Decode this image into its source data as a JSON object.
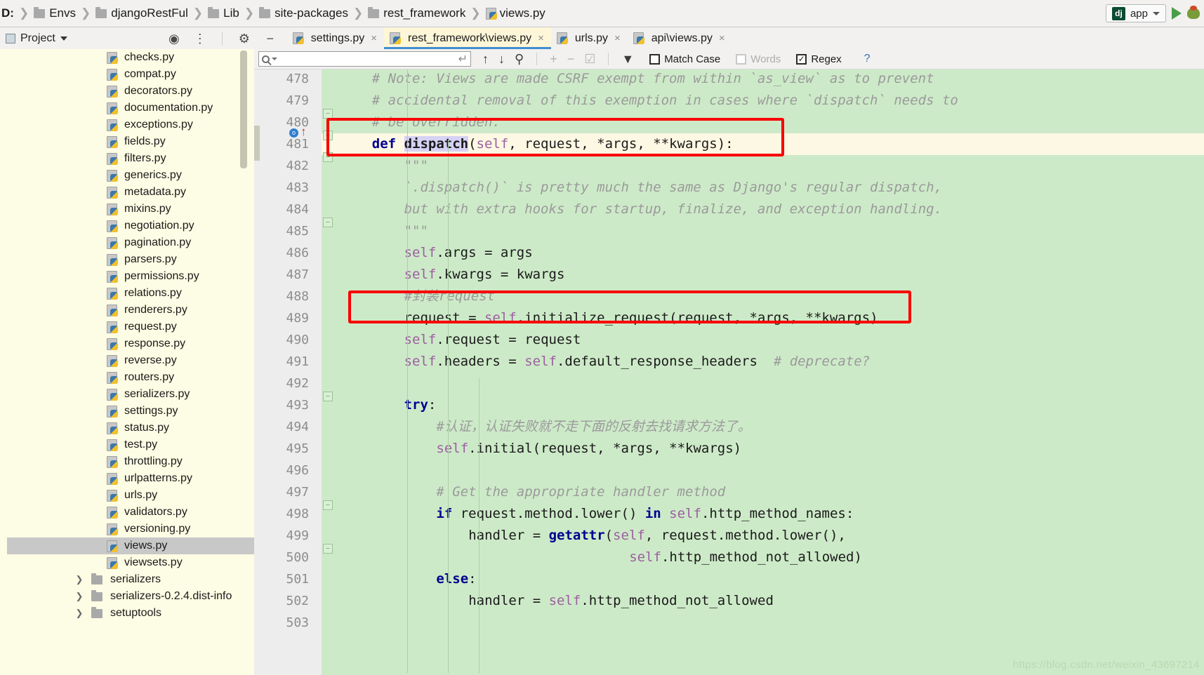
{
  "window": {
    "breadcrumb": [
      {
        "label": "D:",
        "icon": "drive-icon",
        "type": "drive"
      },
      {
        "label": "Envs",
        "icon": "folder-icon",
        "type": "folder"
      },
      {
        "label": "djangoRestFul",
        "icon": "folder-icon",
        "type": "folder"
      },
      {
        "label": "Lib",
        "icon": "folder-icon",
        "type": "folder"
      },
      {
        "label": "site-packages",
        "icon": "folder-icon",
        "type": "folder"
      },
      {
        "label": "rest_framework",
        "icon": "folder-icon",
        "type": "folder"
      },
      {
        "label": "views.py",
        "icon": "python-file-icon",
        "type": "file"
      }
    ],
    "run_config": {
      "badge": "dj",
      "label": "app",
      "icon": "chevron-down-icon"
    },
    "run_button_icon": "run-triangle-icon",
    "debug_button_icon": "debug-bug-icon"
  },
  "toolbar": {
    "project_label": "Project",
    "project_caret_icon": "triangle-down-icon",
    "icons": [
      "locate-target-icon",
      "collapse-all-icon",
      "settings-gear-icon",
      "hide-minus-icon"
    ]
  },
  "tabs": [
    {
      "label": "settings.py",
      "icon": "python-file-icon",
      "close": "×",
      "active": false
    },
    {
      "label": "rest_framework\\views.py",
      "icon": "python-file-icon",
      "close": "×",
      "active": true
    },
    {
      "label": "urls.py",
      "icon": "python-file-icon",
      "close": "×",
      "active": false
    },
    {
      "label": "api\\views.py",
      "icon": "python-file-icon",
      "close": "×",
      "active": false
    }
  ],
  "find": {
    "placeholder": "",
    "value": "",
    "search_icon": "magnifier-icon",
    "dropdown_icon": "caret-down-icon",
    "wrap_icon": "return-arrow-icon",
    "prev_icon": "arrow-up-icon",
    "next_icon": "arrow-down-icon",
    "select_all_icon": "select-all-occurrences-icon",
    "add_line_icon": "add-selection-icon",
    "remove_line_icon": "remove-selection-icon",
    "select_lines_icon": "select-lines-icon",
    "filter_icon": "filter-funnel-icon",
    "match_case": {
      "label": "Match Case",
      "checked": false,
      "enabled": true
    },
    "words": {
      "label": "Words",
      "checked": false,
      "enabled": false
    },
    "regex": {
      "label": "Regex",
      "checked": true,
      "enabled": true
    },
    "help": "?"
  },
  "sidebar": {
    "files": [
      {
        "label": "checks.py",
        "type": "file",
        "selected": false
      },
      {
        "label": "compat.py",
        "type": "file",
        "selected": false
      },
      {
        "label": "decorators.py",
        "type": "file",
        "selected": false
      },
      {
        "label": "documentation.py",
        "type": "file",
        "selected": false
      },
      {
        "label": "exceptions.py",
        "type": "file",
        "selected": false
      },
      {
        "label": "fields.py",
        "type": "file",
        "selected": false
      },
      {
        "label": "filters.py",
        "type": "file",
        "selected": false
      },
      {
        "label": "generics.py",
        "type": "file",
        "selected": false
      },
      {
        "label": "metadata.py",
        "type": "file",
        "selected": false
      },
      {
        "label": "mixins.py",
        "type": "file",
        "selected": false
      },
      {
        "label": "negotiation.py",
        "type": "file",
        "selected": false
      },
      {
        "label": "pagination.py",
        "type": "file",
        "selected": false
      },
      {
        "label": "parsers.py",
        "type": "file",
        "selected": false
      },
      {
        "label": "permissions.py",
        "type": "file",
        "selected": false
      },
      {
        "label": "relations.py",
        "type": "file",
        "selected": false
      },
      {
        "label": "renderers.py",
        "type": "file",
        "selected": false
      },
      {
        "label": "request.py",
        "type": "file",
        "selected": false
      },
      {
        "label": "response.py",
        "type": "file",
        "selected": false
      },
      {
        "label": "reverse.py",
        "type": "file",
        "selected": false
      },
      {
        "label": "routers.py",
        "type": "file",
        "selected": false
      },
      {
        "label": "serializers.py",
        "type": "file",
        "selected": false
      },
      {
        "label": "settings.py",
        "type": "file",
        "selected": false
      },
      {
        "label": "status.py",
        "type": "file",
        "selected": false
      },
      {
        "label": "test.py",
        "type": "file",
        "selected": false
      },
      {
        "label": "throttling.py",
        "type": "file",
        "selected": false
      },
      {
        "label": "urlpatterns.py",
        "type": "file",
        "selected": false
      },
      {
        "label": "urls.py",
        "type": "file",
        "selected": false
      },
      {
        "label": "validators.py",
        "type": "file",
        "selected": false
      },
      {
        "label": "versioning.py",
        "type": "file",
        "selected": false
      },
      {
        "label": "views.py",
        "type": "file",
        "selected": true
      },
      {
        "label": "viewsets.py",
        "type": "file",
        "selected": false
      },
      {
        "label": "serializers",
        "type": "folder",
        "selected": false
      },
      {
        "label": "serializers-0.2.4.dist-info",
        "type": "folder",
        "selected": false
      },
      {
        "label": "setuptools",
        "type": "folder",
        "selected": false
      }
    ]
  },
  "editor": {
    "language": "python",
    "first_line": 478,
    "lines": [
      {
        "num": "478",
        "indent": 4,
        "tokens": [
          {
            "t": "comment",
            "v": "# Note: Views are made CSRF exempt from within `as_view` as to prevent"
          }
        ]
      },
      {
        "num": "479",
        "indent": 4,
        "tokens": [
          {
            "t": "comment",
            "v": "# accidental removal of this exemption in cases where `dispatch` needs to"
          }
        ]
      },
      {
        "num": "480",
        "indent": 4,
        "tokens": [
          {
            "t": "comment",
            "v": "# be overridden."
          }
        ]
      },
      {
        "num": "481",
        "indent": 4,
        "tokens": [
          {
            "t": "kw",
            "v": "def "
          },
          {
            "t": "fn-sel",
            "v": "dispatch"
          },
          {
            "t": "plain",
            "v": "("
          },
          {
            "t": "self",
            "v": "self"
          },
          {
            "t": "plain",
            "v": ", request, *args, **kwargs):"
          }
        ]
      },
      {
        "num": "482",
        "indent": 8,
        "tokens": [
          {
            "t": "docstring",
            "v": "\"\"\""
          }
        ]
      },
      {
        "num": "483",
        "indent": 8,
        "tokens": [
          {
            "t": "docstring",
            "v": "`.dispatch()` is pretty much the same as Django's regular dispatch,"
          }
        ]
      },
      {
        "num": "484",
        "indent": 8,
        "tokens": [
          {
            "t": "docstring",
            "v": "but with extra hooks for startup, finalize, and exception handling."
          }
        ]
      },
      {
        "num": "485",
        "indent": 8,
        "tokens": [
          {
            "t": "docstring",
            "v": "\"\"\""
          }
        ]
      },
      {
        "num": "486",
        "indent": 8,
        "tokens": [
          {
            "t": "self",
            "v": "self"
          },
          {
            "t": "plain",
            "v": ".args = args"
          }
        ]
      },
      {
        "num": "487",
        "indent": 8,
        "tokens": [
          {
            "t": "self",
            "v": "self"
          },
          {
            "t": "plain",
            "v": ".kwargs = kwargs"
          }
        ]
      },
      {
        "num": "488",
        "indent": 8,
        "tokens": [
          {
            "t": "comment",
            "v": "#封装request"
          }
        ]
      },
      {
        "num": "489",
        "indent": 8,
        "tokens": [
          {
            "t": "plain",
            "v": "request = "
          },
          {
            "t": "self",
            "v": "self"
          },
          {
            "t": "plain",
            "v": ".initialize_request(request, *args, **kwargs)"
          }
        ]
      },
      {
        "num": "490",
        "indent": 8,
        "tokens": [
          {
            "t": "self",
            "v": "self"
          },
          {
            "t": "plain",
            "v": ".request = request"
          }
        ]
      },
      {
        "num": "491",
        "indent": 8,
        "tokens": [
          {
            "t": "self",
            "v": "self"
          },
          {
            "t": "plain",
            "v": ".headers = "
          },
          {
            "t": "self",
            "v": "self"
          },
          {
            "t": "plain",
            "v": ".default_response_headers  "
          },
          {
            "t": "comment",
            "v": "# deprecate?"
          }
        ]
      },
      {
        "num": "492",
        "indent": 0,
        "tokens": []
      },
      {
        "num": "493",
        "indent": 8,
        "tokens": [
          {
            "t": "kw",
            "v": "try"
          },
          {
            "t": "plain",
            "v": ":"
          }
        ]
      },
      {
        "num": "494",
        "indent": 12,
        "tokens": [
          {
            "t": "comment",
            "v": "#认证，认证失败就不走下面的反射去找请求方法了。"
          }
        ]
      },
      {
        "num": "495",
        "indent": 12,
        "tokens": [
          {
            "t": "self",
            "v": "self"
          },
          {
            "t": "plain",
            "v": ".initial(request, *args, **kwargs)"
          }
        ]
      },
      {
        "num": "496",
        "indent": 0,
        "tokens": []
      },
      {
        "num": "497",
        "indent": 12,
        "tokens": [
          {
            "t": "comment",
            "v": "# Get the appropriate handler method"
          }
        ]
      },
      {
        "num": "498",
        "indent": 12,
        "tokens": [
          {
            "t": "kw",
            "v": "if"
          },
          {
            "t": "plain",
            "v": " request.method.lower() "
          },
          {
            "t": "kw",
            "v": "in"
          },
          {
            "t": "plain",
            "v": " "
          },
          {
            "t": "self",
            "v": "self"
          },
          {
            "t": "plain",
            "v": ".http_method_names:"
          }
        ]
      },
      {
        "num": "499",
        "indent": 16,
        "tokens": [
          {
            "t": "plain",
            "v": "handler = "
          },
          {
            "t": "builtin",
            "v": "getattr"
          },
          {
            "t": "plain",
            "v": "("
          },
          {
            "t": "self",
            "v": "self"
          },
          {
            "t": "plain",
            "v": ", request.method.lower(),"
          }
        ]
      },
      {
        "num": "500",
        "indent": 36,
        "tokens": [
          {
            "t": "self",
            "v": "self"
          },
          {
            "t": "plain",
            "v": ".http_method_not_allowed)"
          }
        ]
      },
      {
        "num": "501",
        "indent": 12,
        "tokens": [
          {
            "t": "kw",
            "v": "else"
          },
          {
            "t": "plain",
            "v": ":"
          }
        ]
      },
      {
        "num": "502",
        "indent": 16,
        "tokens": [
          {
            "t": "plain",
            "v": "handler = "
          },
          {
            "t": "self",
            "v": "self"
          },
          {
            "t": "plain",
            "v": ".http_method_not_allowed"
          }
        ]
      },
      {
        "num": "503",
        "indent": 0,
        "tokens": []
      }
    ],
    "annotations": [
      {
        "type": "red-rectangle",
        "target_line": "481",
        "color": "#f90000"
      },
      {
        "type": "red-rectangle",
        "target_line": "489",
        "color": "#f90000"
      }
    ],
    "breakpoint_line": "481",
    "highlighted_line": "481"
  },
  "watermark": "https://blog.csdn.net/weixin_43697214",
  "colors": {
    "editor_background": "#cdeac8",
    "sidebar_background": "#fdfce4",
    "chrome_background": "#f2f1f0",
    "active_tab_background": "#fdf6d8",
    "annotation_red": "#f90000",
    "selection_highlight": "#d6d2f5",
    "keyword_blue": "#00008f",
    "self_purple": "#9c5fa0",
    "comment_gray": "#9a9a9a"
  }
}
